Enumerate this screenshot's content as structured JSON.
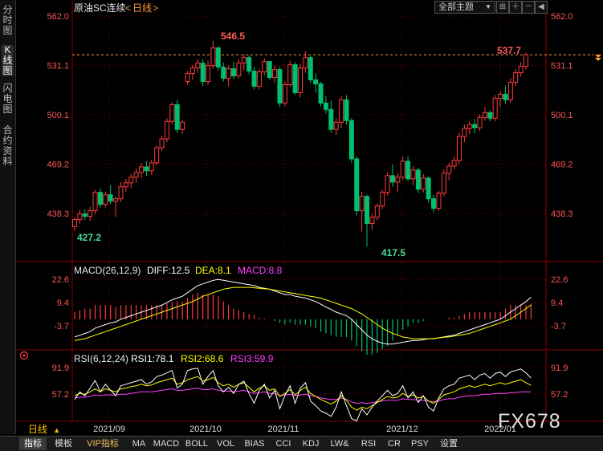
{
  "left_tabs": [
    "分时图",
    "K线图",
    "闪电图",
    "合约资料"
  ],
  "header": {
    "instrument": "原油SC连续",
    "period_open": "<",
    "period": "日线",
    "period_close": ">",
    "dropdown": "全部主题"
  },
  "watermark": "FX678",
  "period_selector": {
    "label": "日线",
    "arrow": "▲"
  },
  "toolbar": [
    "指标",
    "模板",
    "VIP指标",
    "MA",
    "MACD",
    "BOLL",
    "VOL",
    "BIAS",
    "CCI",
    "KDJ",
    "LW&",
    "RSI",
    "CR",
    "PSY",
    "设置"
  ],
  "x_labels": [
    "2021/09",
    "2021/10",
    "2021/11",
    "2021/12",
    "2022/01"
  ],
  "colors": {
    "up": "#ff3b3b",
    "down": "#00c070",
    "diff": "#ffffff",
    "dea": "#ffff00",
    "macd_label": "#ff40ff",
    "rsi1": "#ffffff",
    "rsi2": "#ffff00",
    "rsi3": "#ff40ff",
    "axis": "#ff5555",
    "grid": "#7a0000"
  },
  "chart_data": [
    {
      "type": "candlestick",
      "title": "原油SC连续 日线",
      "y_ticks": [
        "562.0",
        "531.1",
        "500.1",
        "469.2",
        "438.3"
      ],
      "ylim": [
        420,
        563
      ],
      "current_price": "537.7",
      "annotations": {
        "high": "546.5",
        "low": "417.5",
        "first_low": "427.2",
        "last": "537.7"
      },
      "candles": [
        [
          430.0,
          436.0,
          427.2,
          434.5
        ],
        [
          434.5,
          440.5,
          432.0,
          438.0
        ],
        [
          438.0,
          441.0,
          434.0,
          436.5
        ],
        [
          436.5,
          442.5,
          433.5,
          440.0
        ],
        [
          440.0,
          453.0,
          438.0,
          451.5
        ],
        [
          451.5,
          454.0,
          442.0,
          444.0
        ],
        [
          444.0,
          452.0,
          442.0,
          450.0
        ],
        [
          450.0,
          456.0,
          444.0,
          446.0
        ],
        [
          446.0,
          449.0,
          436.0,
          447.5
        ],
        [
          447.5,
          458.0,
          445.5,
          455.0
        ],
        [
          455.0,
          460.0,
          452.0,
          457.5
        ],
        [
          457.5,
          463.0,
          454.0,
          461.0
        ],
        [
          461.0,
          466.5,
          457.5,
          464.0
        ],
        [
          464.0,
          470.0,
          460.5,
          467.5
        ],
        [
          467.5,
          471.0,
          462.0,
          465.0
        ],
        [
          465.0,
          472.0,
          462.5,
          470.0
        ],
        [
          470.0,
          481.0,
          468.5,
          479.5
        ],
        [
          479.5,
          487.0,
          477.5,
          485.0
        ],
        [
          485.0,
          498.0,
          483.0,
          496.0
        ],
        [
          496.0,
          508.0,
          494.0,
          506.5
        ],
        [
          506.5,
          509.5,
          489.0,
          491.0
        ],
        [
          491.0,
          497.0,
          488.0,
          495.5
        ],
        [
          521.0,
          527.5,
          519.0,
          526.0
        ],
        [
          526.0,
          531.5,
          522.0,
          529.5
        ],
        [
          529.5,
          535.0,
          526.5,
          532.5
        ],
        [
          532.5,
          535.0,
          518.0,
          521.0
        ],
        [
          521.0,
          534.0,
          519.0,
          531.0
        ],
        [
          531.0,
          546.5,
          529.0,
          542.0
        ],
        [
          542.0,
          543.0,
          528.0,
          530.0
        ],
        [
          530.0,
          533.0,
          521.0,
          523.0
        ],
        [
          523.0,
          531.0,
          518.0,
          529.0
        ],
        [
          529.0,
          533.5,
          522.5,
          524.5
        ],
        [
          524.5,
          535.0,
          523.0,
          532.5
        ],
        [
          532.5,
          538.0,
          528.0,
          536.0
        ],
        [
          536.0,
          537.5,
          525.5,
          527.5
        ],
        [
          527.5,
          530.0,
          516.0,
          518.0
        ],
        [
          518.0,
          529.0,
          516.0,
          527.0
        ],
        [
          527.0,
          535.5,
          525.0,
          533.5
        ],
        [
          533.5,
          534.0,
          522.0,
          523.5
        ],
        [
          523.5,
          531.0,
          520.0,
          528.5
        ],
        [
          528.5,
          530.0,
          505.0,
          507.5
        ],
        [
          507.5,
          521.0,
          505.5,
          519.0
        ],
        [
          519.0,
          534.0,
          517.5,
          531.5
        ],
        [
          531.5,
          533.0,
          512.5,
          514.0
        ],
        [
          514.0,
          532.0,
          511.0,
          529.5
        ],
        [
          529.5,
          540.0,
          526.5,
          536.0
        ],
        [
          536.0,
          537.0,
          520.0,
          522.0
        ],
        [
          522.0,
          526.0,
          514.0,
          519.5
        ],
        [
          519.5,
          521.0,
          505.5,
          507.5
        ],
        [
          507.5,
          512.0,
          501.0,
          503.5
        ],
        [
          503.5,
          509.0,
          489.0,
          491.0
        ],
        [
          491.0,
          498.0,
          487.5,
          495.5
        ],
        [
          495.5,
          512.0,
          492.0,
          509.5
        ],
        [
          509.5,
          512.5,
          494.0,
          496.5
        ],
        [
          496.5,
          498.0,
          470.0,
          472.5
        ],
        [
          472.5,
          474.0,
          437.0,
          440.0
        ],
        [
          440.0,
          452.0,
          427.0,
          449.0
        ],
        [
          449.0,
          450.0,
          417.5,
          432.0
        ],
        [
          432.0,
          438.0,
          428.0,
          436.0
        ],
        [
          436.0,
          444.5,
          434.0,
          443.0
        ],
        [
          443.0,
          453.0,
          441.0,
          451.5
        ],
        [
          451.5,
          464.0,
          449.5,
          462.0
        ],
        [
          462.0,
          469.0,
          455.0,
          458.0
        ],
        [
          458.0,
          463.5,
          452.0,
          461.0
        ],
        [
          461.0,
          474.0,
          459.0,
          471.0
        ],
        [
          471.0,
          474.0,
          458.5,
          460.0
        ],
        [
          460.0,
          468.0,
          456.0,
          465.5
        ],
        [
          465.5,
          467.0,
          451.0,
          453.5
        ],
        [
          453.5,
          463.0,
          451.5,
          460.5
        ],
        [
          460.5,
          461.5,
          445.0,
          447.5
        ],
        [
          447.5,
          450.0,
          439.0,
          441.5
        ],
        [
          441.5,
          452.5,
          440.0,
          451.0
        ],
        [
          451.0,
          466.0,
          449.0,
          463.5
        ],
        [
          463.5,
          470.0,
          459.0,
          468.0
        ],
        [
          468.0,
          474.0,
          466.0,
          471.5
        ],
        [
          471.5,
          489.0,
          469.5,
          486.5
        ],
        [
          486.5,
          494.0,
          483.0,
          491.5
        ],
        [
          491.5,
          496.0,
          488.0,
          494.0
        ],
        [
          494.0,
          497.5,
          488.5,
          492.0
        ],
        [
          492.0,
          500.5,
          490.0,
          498.5
        ],
        [
          498.5,
          505.0,
          496.5,
          501.5
        ],
        [
          501.5,
          503.0,
          496.0,
          498.0
        ],
        [
          498.0,
          512.5,
          496.0,
          510.5
        ],
        [
          510.5,
          515.0,
          505.0,
          513.0
        ],
        [
          513.0,
          518.5,
          507.0,
          509.5
        ],
        [
          509.5,
          523.0,
          507.5,
          520.5
        ],
        [
          520.5,
          529.0,
          518.0,
          526.5
        ],
        [
          526.5,
          533.0,
          524.0,
          530.5
        ],
        [
          530.5,
          539.0,
          528.5,
          537.7
        ]
      ]
    },
    {
      "type": "line",
      "title": "MACD(26,12,9)",
      "stats": {
        "diff": "DIFF:12.5",
        "dea": "DEA:8.1",
        "macd": "MACD:8.8"
      },
      "y_ticks": [
        "22.6",
        "9.4",
        "-3.7"
      ],
      "ylim": [
        -18,
        26
      ],
      "series": [
        {
          "name": "DIFF",
          "values": [
            -10.0,
            -9.0,
            -8.0,
            -7.0,
            -5.0,
            -4.0,
            -3.0,
            -2.0,
            -1.5,
            0.0,
            1.0,
            2.0,
            3.0,
            4.0,
            5.0,
            6.0,
            7.0,
            8.0,
            9.5,
            11.0,
            12.0,
            13.0,
            15.0,
            17.0,
            19.0,
            20.0,
            21.0,
            22.0,
            22.5,
            22.0,
            21.5,
            21.0,
            20.5,
            20.0,
            19.5,
            19.0,
            18.0,
            17.5,
            17.0,
            16.0,
            15.0,
            14.0,
            14.0,
            13.0,
            12.5,
            12.0,
            11.0,
            10.0,
            8.5,
            7.0,
            5.5,
            4.0,
            3.0,
            2.0,
            0.0,
            -3.0,
            -6.0,
            -9.0,
            -11.0,
            -12.5,
            -13.5,
            -14.0,
            -14.0,
            -13.5,
            -13.0,
            -12.5,
            -12.0,
            -12.0,
            -11.5,
            -11.0,
            -11.0,
            -10.5,
            -10.0,
            -9.5,
            -9.0,
            -8.0,
            -7.0,
            -6.0,
            -5.0,
            -4.0,
            -3.0,
            -2.0,
            -1.0,
            0.0,
            2.0,
            4.0,
            6.0,
            8.0,
            10.0,
            12.5
          ]
        },
        {
          "name": "DEA",
          "values": [
            -12.0,
            -11.5,
            -11.0,
            -10.0,
            -9.0,
            -8.0,
            -7.0,
            -6.0,
            -5.0,
            -4.0,
            -3.0,
            -2.0,
            -1.0,
            0.0,
            1.0,
            2.0,
            3.0,
            4.0,
            5.0,
            6.0,
            7.0,
            8.0,
            9.0,
            10.0,
            11.5,
            13.0,
            14.0,
            15.0,
            16.0,
            17.0,
            17.5,
            18.0,
            18.0,
            18.0,
            18.0,
            17.8,
            17.5,
            17.2,
            17.0,
            16.5,
            16.0,
            15.5,
            15.0,
            14.5,
            14.0,
            13.5,
            13.0,
            12.5,
            12.0,
            11.0,
            10.0,
            9.0,
            8.0,
            7.0,
            6.0,
            4.5,
            3.0,
            1.0,
            -1.0,
            -3.0,
            -5.0,
            -6.5,
            -8.0,
            -9.0,
            -10.0,
            -10.5,
            -11.0,
            -11.0,
            -11.0,
            -11.0,
            -10.8,
            -10.5,
            -10.2,
            -10.0,
            -9.5,
            -9.0,
            -8.5,
            -8.0,
            -7.0,
            -6.0,
            -5.0,
            -4.0,
            -3.0,
            -2.0,
            -1.0,
            0.0,
            2.0,
            4.0,
            6.0,
            8.1
          ]
        },
        {
          "name": "MACD",
          "values": [
            4.0,
            5.0,
            6.0,
            6.0,
            8.0,
            8.0,
            8.0,
            8.0,
            7.0,
            8.0,
            8.0,
            8.0,
            8.0,
            8.0,
            8.0,
            8.0,
            8.0,
            8.0,
            9.0,
            10.0,
            10.0,
            10.0,
            12.0,
            14.0,
            15.0,
            14.0,
            14.0,
            14.0,
            13.0,
            10.0,
            8.0,
            6.0,
            5.0,
            4.0,
            3.0,
            2.4,
            1.0,
            0.6,
            0.0,
            -1.0,
            -2.0,
            -3.0,
            -2.0,
            -3.0,
            -3.0,
            -3.0,
            -4.0,
            -5.0,
            -7.0,
            -8.0,
            -9.0,
            -10.0,
            -10.0,
            -10.0,
            -12.0,
            -15.0,
            -18.0,
            -20.0,
            -20.0,
            -19.0,
            -17.0,
            -15.0,
            -12.0,
            -9.0,
            -6.0,
            -4.0,
            -2.0,
            -2.0,
            -1.0,
            0.0,
            0.0,
            0.0,
            0.0,
            1.0,
            1.0,
            2.0,
            3.0,
            4.0,
            4.0,
            4.0,
            4.0,
            4.0,
            4.0,
            4.0,
            6.0,
            8.0,
            8.0,
            8.0,
            8.0,
            8.8
          ]
        }
      ]
    },
    {
      "type": "line",
      "title": "RSI(6,12,24)",
      "stats": {
        "rsi1": "RSI1:78.1",
        "rsi2": "RSI2:68.6",
        "rsi3": "RSI3:59.9"
      },
      "y_ticks": [
        "91.9",
        "57.2"
      ],
      "ylim": [
        20,
        100
      ],
      "series": [
        {
          "name": "RSI1",
          "values": [
            50,
            60,
            55,
            65,
            75,
            60,
            70,
            62,
            55,
            68,
            70,
            72,
            74,
            76,
            70,
            73,
            80,
            82,
            85,
            88,
            65,
            70,
            88,
            90,
            91,
            70,
            80,
            88,
            68,
            60,
            66,
            58,
            70,
            74,
            58,
            45,
            62,
            70,
            52,
            62,
            38,
            55,
            68,
            45,
            65,
            72,
            48,
            42,
            35,
            32,
            28,
            40,
            60,
            42,
            25,
            22,
            38,
            30,
            40,
            48,
            55,
            62,
            55,
            58,
            68,
            52,
            60,
            46,
            55,
            40,
            35,
            52,
            64,
            68,
            70,
            78,
            80,
            82,
            76,
            82,
            84,
            78,
            84,
            86,
            80,
            86,
            88,
            90,
            85,
            78.1
          ]
        },
        {
          "name": "RSI2",
          "values": [
            55,
            58,
            57,
            60,
            64,
            60,
            64,
            62,
            60,
            64,
            65,
            67,
            68,
            70,
            68,
            69,
            72,
            74,
            76,
            78,
            70,
            72,
            76,
            78,
            80,
            74,
            76,
            79,
            72,
            68,
            70,
            66,
            70,
            72,
            66,
            60,
            65,
            68,
            62,
            64,
            54,
            58,
            63,
            56,
            62,
            66,
            58,
            54,
            50,
            47,
            44,
            48,
            55,
            49,
            40,
            36,
            40,
            38,
            42,
            46,
            50,
            54,
            52,
            53,
            58,
            54,
            56,
            52,
            54,
            48,
            45,
            50,
            56,
            58,
            60,
            64,
            66,
            68,
            66,
            68,
            70,
            68,
            70,
            72,
            70,
            72,
            74,
            76,
            72,
            68.6
          ]
        },
        {
          "name": "RSI3",
          "values": [
            52,
            53,
            53,
            54,
            56,
            55,
            56,
            56,
            56,
            57,
            57,
            58,
            59,
            60,
            60,
            60,
            61,
            62,
            63,
            64,
            62,
            62,
            63,
            64,
            65,
            63,
            63,
            64,
            62,
            61,
            61,
            60,
            61,
            62,
            60,
            58,
            59,
            60,
            58,
            58,
            55,
            56,
            57,
            55,
            56,
            57,
            55,
            54,
            52,
            51,
            50,
            50,
            52,
            50,
            47,
            45,
            46,
            45,
            46,
            47,
            48,
            49,
            49,
            49,
            51,
            50,
            50,
            49,
            49,
            48,
            47,
            48,
            50,
            51,
            51,
            53,
            54,
            55,
            55,
            56,
            57,
            57,
            58,
            58,
            58,
            59,
            59,
            60,
            60,
            59.9
          ]
        }
      ]
    }
  ]
}
